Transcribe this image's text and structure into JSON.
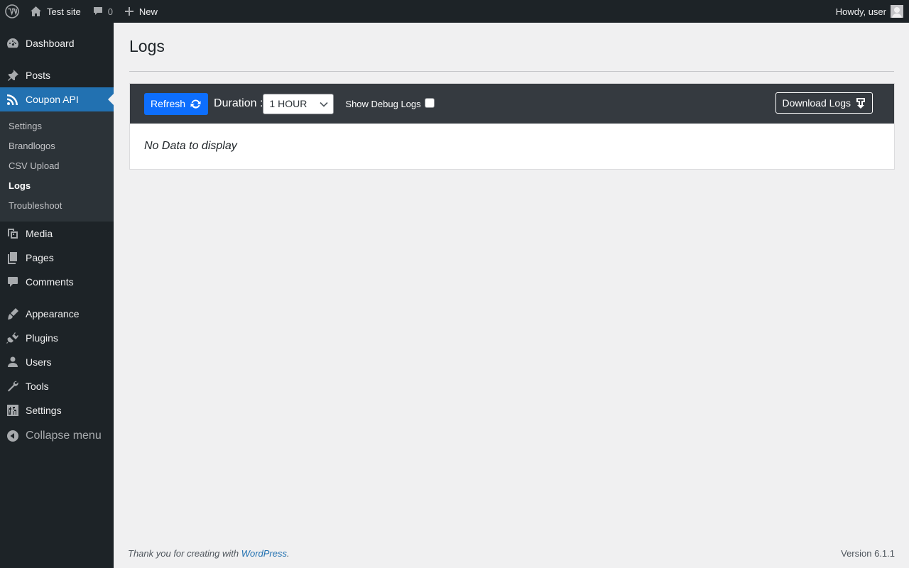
{
  "adminbar": {
    "site_name": "Test site",
    "comment_count": "0",
    "new_label": "New",
    "greeting": "Howdy, user"
  },
  "sidebar": {
    "items": [
      {
        "label": "Dashboard",
        "icon": "dashboard-icon"
      },
      {
        "label": "Posts",
        "icon": "pin-icon"
      },
      {
        "label": "Coupon API",
        "icon": "rss-icon"
      },
      {
        "label": "Media",
        "icon": "media-icon"
      },
      {
        "label": "Pages",
        "icon": "pages-icon"
      },
      {
        "label": "Comments",
        "icon": "comment-icon"
      },
      {
        "label": "Appearance",
        "icon": "brush-icon"
      },
      {
        "label": "Plugins",
        "icon": "plugin-icon"
      },
      {
        "label": "Users",
        "icon": "user-icon"
      },
      {
        "label": "Tools",
        "icon": "wrench-icon"
      },
      {
        "label": "Settings",
        "icon": "settings-icon"
      }
    ],
    "submenu": [
      "Settings",
      "Brandlogos",
      "CSV Upload",
      "Logs",
      "Troubleshoot"
    ],
    "collapse_label": "Collapse menu"
  },
  "page": {
    "title": "Logs",
    "refresh_label": "Refresh",
    "duration_label": "Duration :",
    "duration_value": "1 HOUR",
    "debug_label": "Show Debug Logs",
    "download_label": "Download Logs",
    "empty_message": "No Data to display"
  },
  "footer": {
    "thanks_text": "Thank you for creating with ",
    "link_text": "WordPress",
    "suffix": ".",
    "version": "Version 6.1.1"
  },
  "colors": {
    "accent": "#2271b1",
    "admin_dark": "#1d2327",
    "toolbar": "#353a40",
    "refresh_button": "#0d6efd"
  }
}
